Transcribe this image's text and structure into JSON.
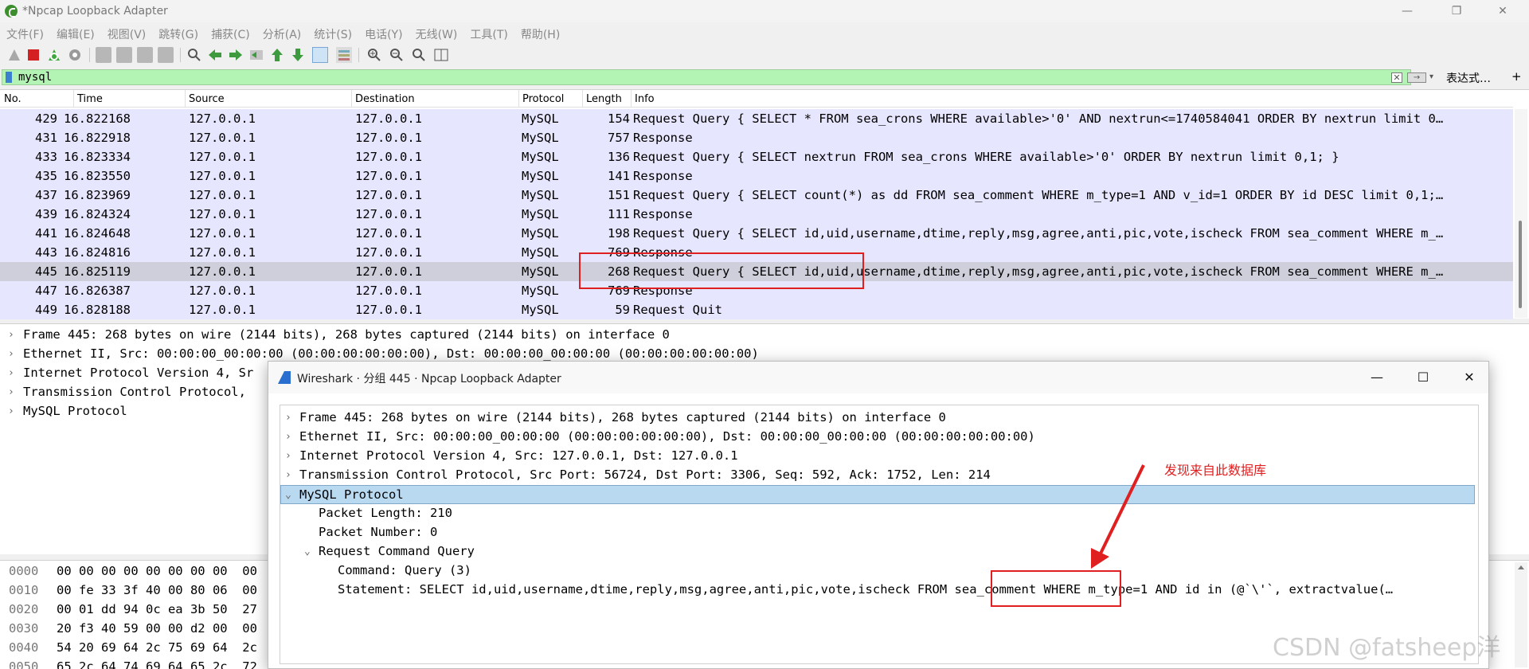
{
  "window": {
    "title": "*Npcap Loopback Adapter",
    "minimize": "—",
    "restore": "❐",
    "close": "✕"
  },
  "menu": [
    "文件(F)",
    "编辑(E)",
    "视图(V)",
    "跳转(G)",
    "捕获(C)",
    "分析(A)",
    "统计(S)",
    "电话(Y)",
    "无线(W)",
    "工具(T)",
    "帮助(H)"
  ],
  "filter": {
    "value": "mysql",
    "clear": "✕",
    "apply": "→",
    "recent": "▾",
    "expression_label": "表达式…",
    "add": "+"
  },
  "packet_list": {
    "columns": [
      "No.",
      "Time",
      "Source",
      "Destination",
      "Protocol",
      "Length",
      "Info"
    ],
    "rows": [
      {
        "no": "429",
        "time": "16.822168",
        "src": "127.0.0.1",
        "dst": "127.0.0.1",
        "proto": "MySQL",
        "len": "154",
        "info": "Request Query { SELECT * FROM sea_crons WHERE available>'0' AND nextrun<=1740584041 ORDER BY nextrun limit 0…"
      },
      {
        "no": "431",
        "time": "16.822918",
        "src": "127.0.0.1",
        "dst": "127.0.0.1",
        "proto": "MySQL",
        "len": "757",
        "info": "Response"
      },
      {
        "no": "433",
        "time": "16.823334",
        "src": "127.0.0.1",
        "dst": "127.0.0.1",
        "proto": "MySQL",
        "len": "136",
        "info": "Request Query { SELECT nextrun FROM sea_crons WHERE available>'0' ORDER BY nextrun limit 0,1; }"
      },
      {
        "no": "435",
        "time": "16.823550",
        "src": "127.0.0.1",
        "dst": "127.0.0.1",
        "proto": "MySQL",
        "len": "141",
        "info": "Response"
      },
      {
        "no": "437",
        "time": "16.823969",
        "src": "127.0.0.1",
        "dst": "127.0.0.1",
        "proto": "MySQL",
        "len": "151",
        "info": "Request Query { SELECT count(*) as dd FROM sea_comment WHERE m_type=1 AND v_id=1 ORDER BY id DESC limit 0,1;…"
      },
      {
        "no": "439",
        "time": "16.824324",
        "src": "127.0.0.1",
        "dst": "127.0.0.1",
        "proto": "MySQL",
        "len": "111",
        "info": "Response"
      },
      {
        "no": "441",
        "time": "16.824648",
        "src": "127.0.0.1",
        "dst": "127.0.0.1",
        "proto": "MySQL",
        "len": "198",
        "info": "Request Query { SELECT id,uid,username,dtime,reply,msg,agree,anti,pic,vote,ischeck FROM sea_comment WHERE m_…"
      },
      {
        "no": "443",
        "time": "16.824816",
        "src": "127.0.0.1",
        "dst": "127.0.0.1",
        "proto": "MySQL",
        "len": "769",
        "info": "Response"
      },
      {
        "no": "445",
        "time": "16.825119",
        "src": "127.0.0.1",
        "dst": "127.0.0.1",
        "proto": "MySQL",
        "len": "268",
        "info": "Request Query { SELECT id,uid,username,dtime,reply,msg,agree,anti,pic,vote,ischeck FROM sea_comment WHERE m_…"
      },
      {
        "no": "447",
        "time": "16.826387",
        "src": "127.0.0.1",
        "dst": "127.0.0.1",
        "proto": "MySQL",
        "len": "769",
        "info": "Response"
      },
      {
        "no": "449",
        "time": "16.828188",
        "src": "127.0.0.1",
        "dst": "127.0.0.1",
        "proto": "MySQL",
        "len": "59",
        "info": "Request Quit"
      }
    ],
    "selected_no": "445"
  },
  "details": [
    "Frame 445: 268 bytes on wire (2144 bits), 268 bytes captured (2144 bits) on interface 0",
    "Ethernet II, Src: 00:00:00_00:00:00 (00:00:00:00:00:00), Dst: 00:00:00_00:00:00 (00:00:00:00:00:00)",
    "Internet Protocol Version 4, Sr",
    "Transmission Control Protocol,",
    "MySQL Protocol"
  ],
  "bytes": [
    {
      "offset": "0000",
      "hex": "00 00 00 00 00 00 00 00  00"
    },
    {
      "offset": "0010",
      "hex": "00 fe 33 3f 40 00 80 06  00"
    },
    {
      "offset": "0020",
      "hex": "00 01 dd 94 0c ea 3b 50  27"
    },
    {
      "offset": "0030",
      "hex": "20 f3 40 59 00 00 d2 00  00"
    },
    {
      "offset": "0040",
      "hex": "54 20 69 64 2c 75 69 64  2c"
    },
    {
      "offset": "0050",
      "hex": "65 2c 64 74 69 64 65 2c  72"
    }
  ],
  "dialog": {
    "title": "Wireshark · 分组 445 · Npcap Loopback Adapter",
    "minimize": "—",
    "maximize": "☐",
    "close": "✕",
    "tree": [
      {
        "text": "Frame 445: 268 bytes on wire (2144 bits), 268 bytes captured (2144 bits) on interface 0",
        "arrow": "›",
        "indent": 0
      },
      {
        "text": "Ethernet II, Src: 00:00:00_00:00:00 (00:00:00:00:00:00), Dst: 00:00:00_00:00:00 (00:00:00:00:00:00)",
        "arrow": "›",
        "indent": 0
      },
      {
        "text": "Internet Protocol Version 4, Src: 127.0.0.1, Dst: 127.0.0.1",
        "arrow": "›",
        "indent": 0
      },
      {
        "text": "Transmission Control Protocol, Src Port: 56724, Dst Port: 3306, Seq: 592, Ack: 1752, Len: 214",
        "arrow": "›",
        "indent": 0
      },
      {
        "text": "MySQL Protocol",
        "arrow": "⌄",
        "indent": 0
      },
      {
        "text": "Packet Length: 210",
        "arrow": "",
        "indent": 1
      },
      {
        "text": "Packet Number: 0",
        "arrow": "",
        "indent": 1
      },
      {
        "text": "Request Command Query",
        "arrow": "⌄",
        "indent": 1
      },
      {
        "text": "Command: Query (3)",
        "arrow": "",
        "indent": 2
      },
      {
        "text": "Statement: SELECT id,uid,username,dtime,reply,msg,agree,anti,pic,vote,ischeck FROM sea_comment WHERE m_type=1 AND id in (@`\\'`, extractvalue(…",
        "arrow": "",
        "indent": 2
      }
    ]
  },
  "annotation": {
    "text": "发现来自此数据库",
    "color": "#e02020"
  },
  "watermark": "CSDN @fatsheep洋",
  "colors": {
    "row_bg": "#e7e6ff",
    "row_selected": "#cfcfdc",
    "filter_ok": "#b3f3b3",
    "tree_selected": "#b9d9f1"
  }
}
